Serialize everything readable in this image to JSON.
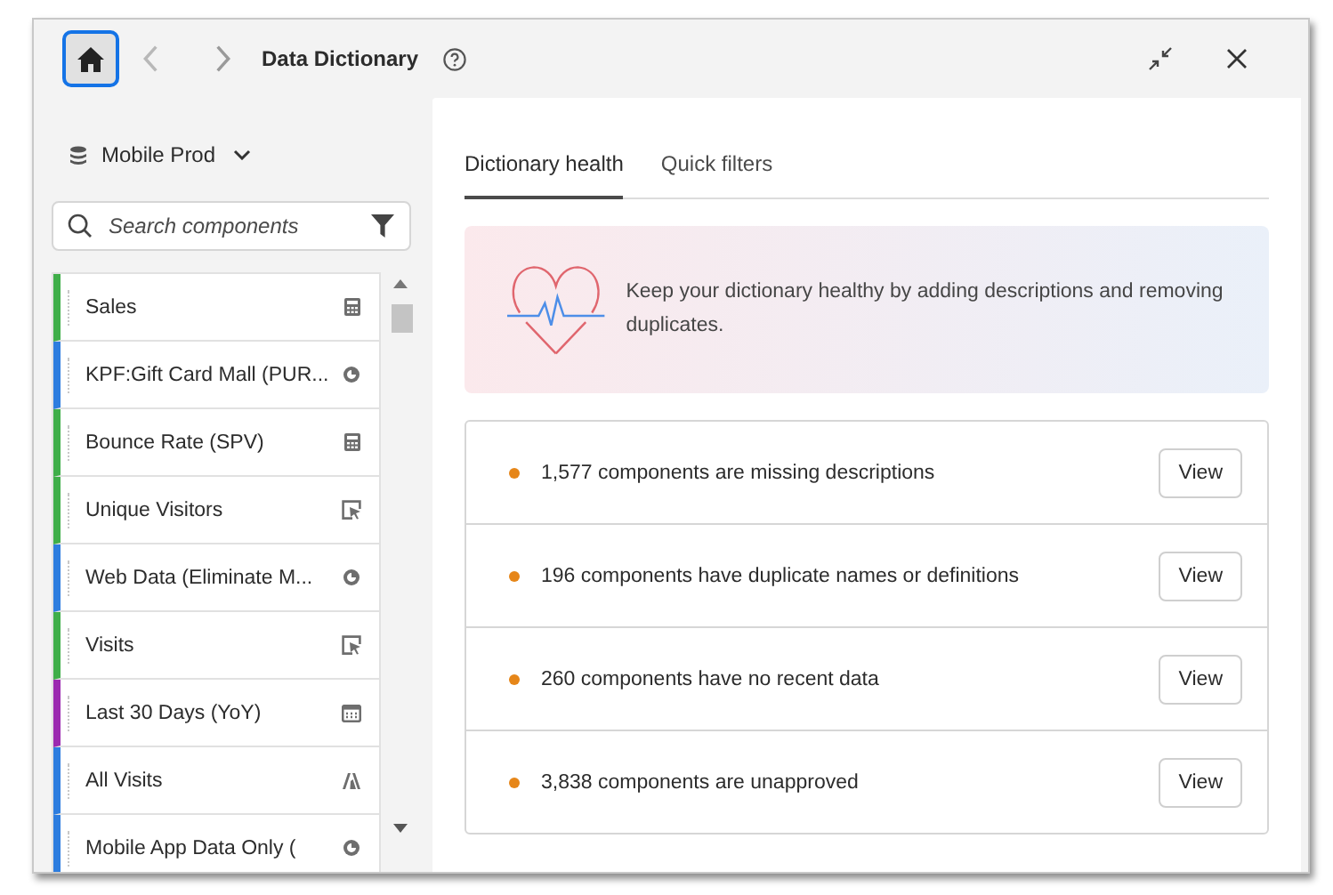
{
  "header": {
    "title": "Data Dictionary"
  },
  "sidebar": {
    "data_view": "Mobile Prod",
    "search": {
      "placeholder": "Search components"
    },
    "items": [
      {
        "label": "Sales",
        "kind": "metric",
        "color": "#3fae49"
      },
      {
        "label": "KPF:Gift Card Mall (PUR...",
        "kind": "segment",
        "color": "#2d7ddf"
      },
      {
        "label": "Bounce Rate (SPV)",
        "kind": "metric",
        "color": "#3fae49"
      },
      {
        "label": "Unique Visitors",
        "kind": "dimension",
        "color": "#3fae49"
      },
      {
        "label": "Web Data (Eliminate M...",
        "kind": "segment",
        "color": "#2d7ddf"
      },
      {
        "label": "Visits",
        "kind": "dimension",
        "color": "#3fae49"
      },
      {
        "label": "Last 30 Days (YoY)",
        "kind": "daterange",
        "color": "#9b2ab0"
      },
      {
        "label": "All Visits",
        "kind": "system",
        "color": "#2d7ddf"
      },
      {
        "label": "Mobile App Data Only (",
        "kind": "segment",
        "color": "#2d7ddf"
      }
    ]
  },
  "tabs": [
    {
      "label": "Dictionary health",
      "selected": true
    },
    {
      "label": "Quick filters",
      "selected": false
    }
  ],
  "banner": {
    "text": "Keep your dictionary healthy by adding descriptions and removing duplicates."
  },
  "issues": [
    {
      "text": "1,577 components are missing descriptions",
      "button": "View"
    },
    {
      "text": "196 components have duplicate names or definitions",
      "button": "View"
    },
    {
      "text": "260 components have no recent data",
      "button": "View"
    },
    {
      "text": "3,838 components are unapproved",
      "button": "View"
    }
  ]
}
